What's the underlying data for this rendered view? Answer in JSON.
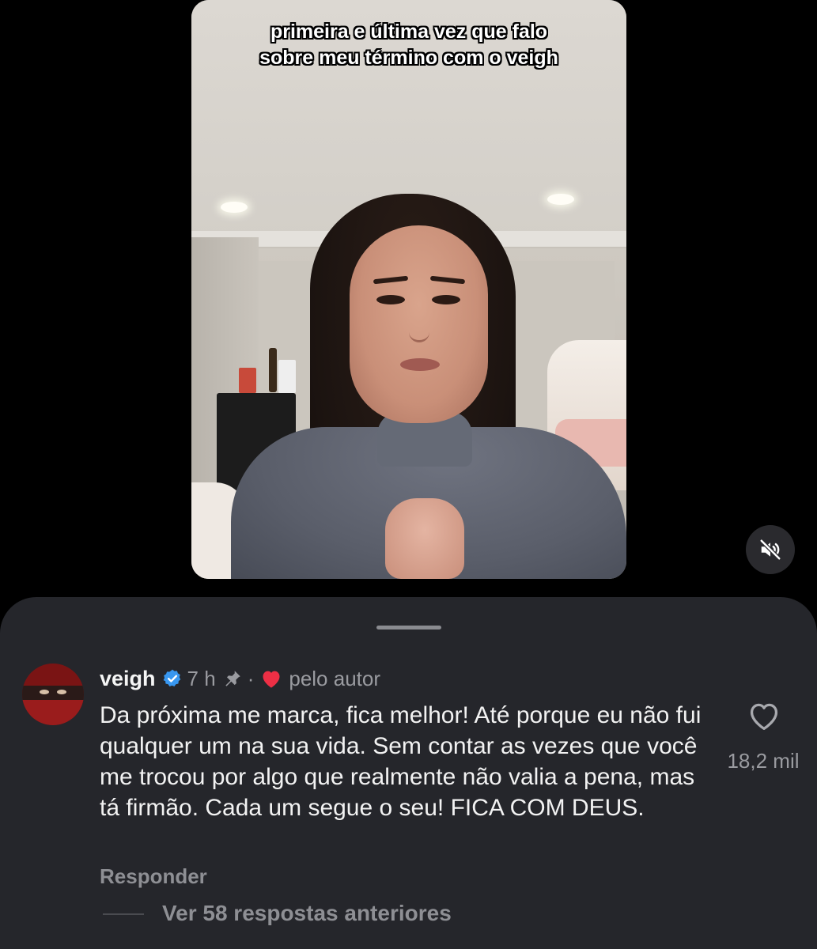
{
  "video": {
    "caption": "primeira e última vez que falo sobre meu término com o veigh",
    "mute_icon": "speaker-muted-icon"
  },
  "comment": {
    "username": "veigh",
    "verified_icon": "verified-badge-icon",
    "time": "7 h",
    "pin_icon": "pin-icon",
    "separator": "·",
    "liked_by_author_icon": "heart-filled-icon",
    "liked_by_author_label": "pelo autor",
    "text": "Da próxima me marca, fica melhor! Até porque eu não fui qualquer um na sua vida. Sem contar as vezes que você me trocou por algo que realmente não valia a pena, mas tá firmão. Cada um segue o seu! FICA COM DEUS.",
    "like_icon": "heart-outline-icon",
    "like_count": "18,2 mil",
    "reply_label": "Responder",
    "view_replies_label": "Ver 58 respostas anteriores"
  },
  "colors": {
    "background": "#000000",
    "sheet": "#25262b",
    "verified_blue": "#3897f0",
    "heart_red": "#ed2f45",
    "muted_text": "#9a9ba0"
  }
}
